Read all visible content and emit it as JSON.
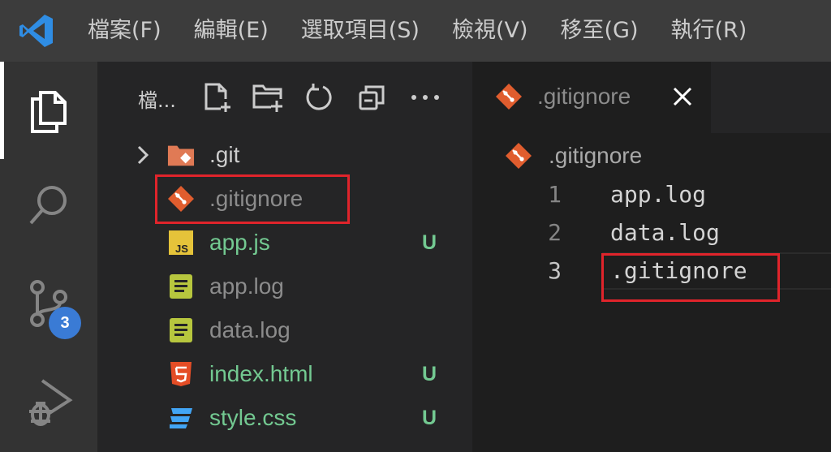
{
  "menubar": {
    "items": [
      "檔案(F)",
      "編輯(E)",
      "選取項目(S)",
      "檢視(V)",
      "移至(G)",
      "執行(R)"
    ]
  },
  "activity_bar": {
    "items": [
      "explorer-icon",
      "search-icon",
      "source-control-icon",
      "run-debug-icon"
    ],
    "source_control_badge": "3"
  },
  "explorer": {
    "title": "檔...",
    "actions": [
      "new-file-icon",
      "new-folder-icon",
      "refresh-icon",
      "collapse-all-icon",
      "more-icon"
    ],
    "files": [
      {
        "label": ".git",
        "icon": "git-folder-icon",
        "status": ""
      },
      {
        "label": ".gitignore",
        "icon": "git-file-icon",
        "status": ""
      },
      {
        "label": "app.js",
        "icon": "js-file-icon",
        "status": "U"
      },
      {
        "label": "app.log",
        "icon": "log-file-icon",
        "status": ""
      },
      {
        "label": "data.log",
        "icon": "log-file-icon",
        "status": ""
      },
      {
        "label": "index.html",
        "icon": "html-file-icon",
        "status": "U"
      },
      {
        "label": "style.css",
        "icon": "css-file-icon",
        "status": "U"
      }
    ]
  },
  "editor": {
    "tab_label": ".gitignore",
    "breadcrumb": ".gitignore",
    "lines": [
      {
        "num": "1",
        "text": "app.log"
      },
      {
        "num": "2",
        "text": "data.log"
      },
      {
        "num": "3",
        "text": ".gitignore"
      }
    ]
  },
  "colors": {
    "highlight": "#e0242b",
    "untracked": "#73c991",
    "git_orange": "#e05d2e",
    "badge": "#3a7bd5"
  }
}
